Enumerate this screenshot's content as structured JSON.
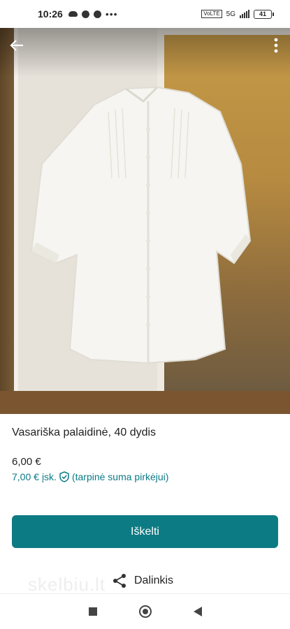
{
  "status_bar": {
    "time": "10:26",
    "battery": "41",
    "network_label": "VoLTE",
    "signal_label": "5G"
  },
  "photo": {
    "description_icon_back": "arrow-left-icon",
    "description_icon_menu": "more-vert-icon"
  },
  "listing": {
    "title": "Vasariška palaidinė, 40 dydis",
    "price": "6,00 €",
    "price_total": "7,00 €",
    "price_total_suffix": "įsk.",
    "buyer_fee_note": "(tarpinė suma pirkėjui)"
  },
  "actions": {
    "promote_label": "Iškelti",
    "share_label": "Dalinkis"
  },
  "watermark": "skelbiu.lt",
  "colors": {
    "accent": "#0d7b83",
    "accent_text": "#0a7a85"
  }
}
